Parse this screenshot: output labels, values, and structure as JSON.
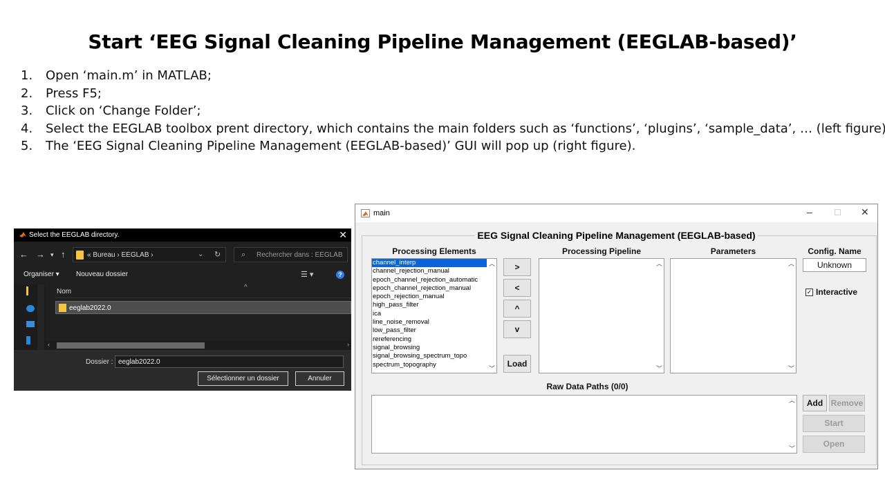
{
  "slide": {
    "title": "Start ‘EEG Signal Cleaning Pipeline Management (EEGLAB-based)’",
    "steps": [
      {
        "num": "1.",
        "text": "Open ‘main.m’ in MATLAB;"
      },
      {
        "num": "2.",
        "text": "Press F5;"
      },
      {
        "num": "3.",
        "text": "Click on ‘Change Folder’;"
      },
      {
        "num": "4.",
        "text": "Select the EEGLAB toolbox prent directory, which contains the main folders such as ‘functions’, ‘plugins’, ‘sample_data’, … (left figure);"
      },
      {
        "num": "5.",
        "text": "The ‘EEG Signal Cleaning Pipeline Management (EEGLAB-based)’ GUI will pop up (right figure)."
      }
    ]
  },
  "folder_dialog": {
    "title": "Select the EEGLAB directory.",
    "close": "✕",
    "address": "«  Bureau  ›  EEGLAB  ›",
    "search_placeholder": "Rechercher dans : EEGLAB",
    "organize": "Organiser ▾",
    "new_folder": "Nouveau dossier",
    "column_name": "Nom",
    "items": [
      {
        "name": "eeglab2022.0"
      }
    ],
    "folder_label": "Dossier :",
    "folder_value": "eeglab2022.0",
    "select_button": "Sélectionner un dossier",
    "cancel_button": "Annuler"
  },
  "main_window": {
    "title": "main",
    "panel_title": "EEG Signal Cleaning Pipeline Management (EEGLAB-based)",
    "processing_elements_header": "Processing Elements",
    "processing_pipeline_header": "Processing Pipeline",
    "parameters_header": "Parameters",
    "config_name_header": "Config. Name",
    "config_name_value": "Unknown",
    "interactive_label": "Interactive",
    "interactive_checked": true,
    "processing_elements": [
      "channel_interp",
      "channel_rejection_manual",
      "epoch_channel_rejection_automatic",
      "epoch_channel_rejection_manual",
      "epoch_rejection_manual",
      "high_pass_filter",
      "ica",
      "line_noise_removal",
      "low_pass_filter",
      "rereferencing",
      "signal_browsing",
      "signal_browsing_spectrum_topo",
      "spectrum_topography"
    ],
    "selected_element": "channel_interp",
    "buttons": {
      "move_right": ">",
      "move_left": "<",
      "move_up": "^",
      "move_down": "v",
      "load": "Load",
      "add": "Add",
      "remove": "Remove",
      "start": "Start",
      "open": "Open"
    },
    "raw_data_paths_label": "Raw Data Paths (0/0)"
  }
}
